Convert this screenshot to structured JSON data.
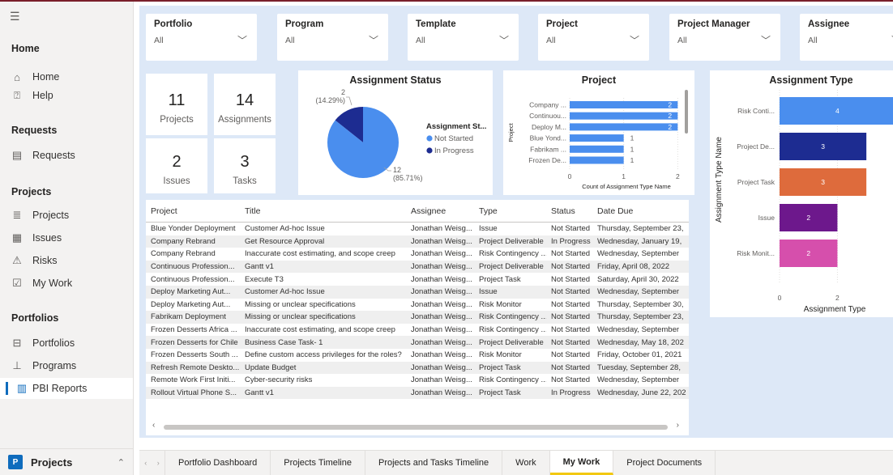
{
  "sidebar": {
    "sections": [
      {
        "title": "Home",
        "items": [
          {
            "label": "Home",
            "icon": "home-icon"
          },
          {
            "label": "Help",
            "icon": "help-icon"
          }
        ]
      },
      {
        "title": "Requests",
        "items": [
          {
            "label": "Requests",
            "icon": "requests-icon"
          }
        ]
      },
      {
        "title": "Projects",
        "items": [
          {
            "label": "Projects",
            "icon": "projects-icon"
          },
          {
            "label": "Issues",
            "icon": "issues-icon"
          },
          {
            "label": "Risks",
            "icon": "risks-icon"
          },
          {
            "label": "My Work",
            "icon": "my-work-icon"
          }
        ]
      },
      {
        "title": "Portfolios",
        "items": [
          {
            "label": "Portfolios",
            "icon": "portfolios-icon"
          },
          {
            "label": "Programs",
            "icon": "programs-icon"
          },
          {
            "label": "PBI Reports",
            "icon": "pbi-reports-icon"
          }
        ]
      }
    ],
    "bottom": {
      "badge": "P",
      "title": "Projects"
    }
  },
  "slicers": [
    {
      "label": "Portfolio",
      "value": "All"
    },
    {
      "label": "Program",
      "value": "All"
    },
    {
      "label": "Template",
      "value": "All"
    },
    {
      "label": "Project",
      "value": "All"
    },
    {
      "label": "Project Manager",
      "value": "All"
    },
    {
      "label": "Assignee",
      "value": "All"
    }
  ],
  "cards": [
    {
      "value": "11",
      "label": "Projects"
    },
    {
      "value": "14",
      "label": "Assignments"
    },
    {
      "value": "2",
      "label": "Issues"
    },
    {
      "value": "3",
      "label": "Tasks"
    }
  ],
  "chart_data": [
    {
      "type": "pie",
      "title": "Assignment Status",
      "legend_title": "Assignment St...",
      "slices": [
        {
          "name": "Not Started",
          "value": 12,
          "label": "12",
          "pct_label": "(85.71%)",
          "color": "#4a8eee"
        },
        {
          "name": "In Progress",
          "value": 2,
          "label": "2",
          "pct_label": "(14.29%)",
          "color": "#1d2c91"
        }
      ]
    },
    {
      "type": "bar",
      "orientation": "horizontal",
      "title": "Project",
      "ylabel": "Project",
      "xlabel": "Count of Assignment Type Name",
      "categories": [
        "Company ...",
        "Continuou...",
        "Deploy M...",
        "Blue Yond...",
        "Fabrikam ...",
        "Frozen De..."
      ],
      "values": [
        2,
        2,
        2,
        1,
        1,
        1
      ],
      "xticks": [
        "0",
        "1",
        "2"
      ],
      "xlim": [
        0,
        2.1
      ],
      "color": "#4a8eee"
    },
    {
      "type": "bar",
      "orientation": "horizontal",
      "title": "Assignment Type",
      "ylabel": "Assignment Type Name",
      "xlabel": "Assignment Type",
      "categories": [
        "Risk Conti...",
        "Project De...",
        "Project Task",
        "Issue",
        "Risk Monit..."
      ],
      "values": [
        4,
        3,
        3,
        2,
        2
      ],
      "colors": [
        "#4a8eee",
        "#1d2c91",
        "#de6b3c",
        "#6d188c",
        "#d64fac"
      ],
      "xticks": [
        "0",
        "2",
        "4"
      ],
      "xlim": [
        0,
        4.2
      ]
    }
  ],
  "table": {
    "headers": [
      "Project",
      "Title",
      "Assignee",
      "Type",
      "Status",
      "Date Due"
    ],
    "rows": [
      [
        "Blue Yonder Deployment",
        "Customer Ad-hoc Issue",
        "Jonathan Weisg...",
        "Issue",
        "Not Started",
        "Thursday, September 23,"
      ],
      [
        "Company Rebrand",
        "Get Resource Approval",
        "Jonathan Weisg...",
        "Project Deliverable",
        "In Progress",
        "Wednesday, January 19,"
      ],
      [
        "Company Rebrand",
        "Inaccurate cost estimating, and scope creep",
        "Jonathan Weisg...",
        "Risk Contingency ...",
        "Not Started",
        "Wednesday, September"
      ],
      [
        "Continuous Profession...",
        "Gantt v1",
        "Jonathan Weisg...",
        "Project Deliverable",
        "Not Started",
        "Friday, April 08, 2022"
      ],
      [
        "Continuous Profession...",
        "Execute T3",
        "Jonathan Weisg...",
        "Project Task",
        "Not Started",
        "Saturday, April 30, 2022"
      ],
      [
        "Deploy Marketing Aut...",
        "Customer Ad-hoc Issue",
        "Jonathan Weisg...",
        "Issue",
        "Not Started",
        "Wednesday, September"
      ],
      [
        "Deploy Marketing Aut...",
        "Missing or unclear specifications",
        "Jonathan Weisg...",
        "Risk Monitor",
        "Not Started",
        "Thursday, September 30,"
      ],
      [
        "Fabrikam Deployment",
        "Missing or unclear specifications",
        "Jonathan Weisg...",
        "Risk Contingency ...",
        "Not Started",
        "Thursday, September 23,"
      ],
      [
        "Frozen Desserts Africa ...",
        "Inaccurate cost estimating, and scope creep",
        "Jonathan Weisg...",
        "Risk Contingency ...",
        "Not Started",
        "Wednesday, September"
      ],
      [
        "Frozen Desserts for Chile",
        "Business Case Task- 1",
        "Jonathan Weisg...",
        "Project Deliverable",
        "Not Started",
        "Wednesday, May 18, 202"
      ],
      [
        "Frozen Desserts South ...",
        "Define custom access privileges for the roles?",
        "Jonathan Weisg...",
        "Risk Monitor",
        "Not Started",
        "Friday, October 01, 2021"
      ],
      [
        "Refresh Remote Deskto...",
        "Update Budget",
        "Jonathan Weisg...",
        "Project Task",
        "Not Started",
        "Tuesday, September 28,"
      ],
      [
        "Remote Work First Initi...",
        "Cyber-security risks",
        "Jonathan Weisg...",
        "Risk Contingency ...",
        "Not Started",
        "Wednesday, September"
      ],
      [
        "Rollout Virtual Phone S...",
        "Gantt v1",
        "Jonathan Weisg...",
        "Project Task",
        "In Progress",
        "Wednesday, June 22, 202"
      ]
    ]
  },
  "tabs": [
    "Portfolio Dashboard",
    "Projects Timeline",
    "Projects and Tasks Timeline",
    "Work",
    "My Work",
    "Project Documents"
  ],
  "active_tab": "My Work"
}
